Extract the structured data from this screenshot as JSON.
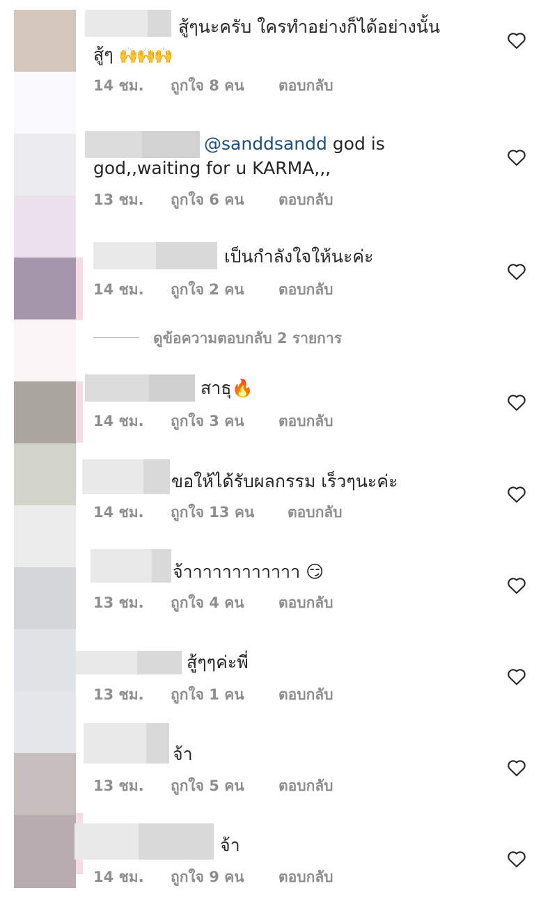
{
  "avatars": [
    "#d3c6bd",
    "#f9f8fa",
    "#ececee",
    "#ebe0eb",
    "#a696ac",
    "#faf4f7",
    "#aba59f",
    "#d2d4c9",
    "#ececec",
    "#d4d6d8",
    "#dfe3e6",
    "#e4e6ea",
    "#c6bebd",
    "#b9acb1"
  ],
  "comments": [
    {
      "line1": "สู้ๆนะครับ ใครทำอย่างก็ได้อย่างนั้น",
      "line2": "สู้ๆ",
      "emoji": "🙌🙌🙌",
      "time": "14 ชม.",
      "likes": "ถูกใจ 8 คน",
      "reply": "ตอบกลับ"
    },
    {
      "mention": "@sanddsandd",
      "line1": " god is",
      "line2": "god,,waiting for u KARMA,,,",
      "time": "13 ชม.",
      "likes": "ถูกใจ 6 คน",
      "reply": "ตอบกลับ"
    },
    {
      "line1": "เป็นกำลังใจให้นะค่ะ",
      "time": "14 ชม.",
      "likes": "ถูกใจ 2 คน",
      "reply": "ตอบกลับ"
    },
    {
      "line1": "สาธุ",
      "emoji": "🔥",
      "time": "14 ชม.",
      "likes": "ถูกใจ 3 คน",
      "reply": "ตอบกลับ"
    },
    {
      "line1": "ขอให้ได้รับผลกรรม เร็วๆนะค่ะ",
      "time": "14 ชม.",
      "likes": "ถูกใจ 13 คน",
      "reply": "ตอบกลับ"
    },
    {
      "line1": "จ้าาาาาาาาาาาา",
      "emoji": "😏",
      "time": "13 ชม.",
      "likes": "ถูกใจ 4 คน",
      "reply": "ตอบกลับ"
    },
    {
      "line1": "สู้ๆๆค่ะพี่",
      "time": "13 ชม.",
      "likes": "ถูกใจ 1 คน",
      "reply": "ตอบกลับ"
    },
    {
      "line1": "จ้า",
      "time": "13 ชม.",
      "likes": "ถูกใจ 5 คน",
      "reply": "ตอบกลับ"
    },
    {
      "line1": "จ้า",
      "time": "14 ชม.",
      "likes": "ถูกใจ 9 คน",
      "reply": "ตอบกลับ"
    }
  ],
  "view_replies": "ดูข้อความตอบกลับ 2 รายการ",
  "icons": {
    "like": "heart-outline-icon"
  }
}
